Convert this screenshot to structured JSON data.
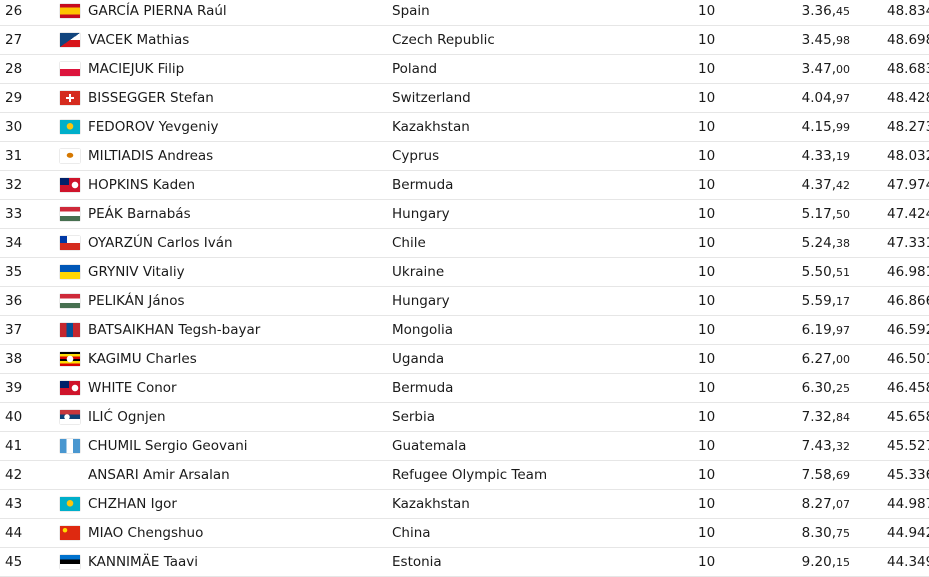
{
  "rows": [
    {
      "rank": "26",
      "name": "GARCÍA PIERNA Raúl",
      "country": "Spain",
      "flag": "spain-flag-icon",
      "laps": "10",
      "time": "3.36,",
      "time_frac": "45",
      "points": "48.834"
    },
    {
      "rank": "27",
      "name": "VACEK Mathias",
      "country": "Czech Republic",
      "flag": "czech-flag-icon",
      "laps": "10",
      "time": "3.45,",
      "time_frac": "98",
      "points": "48.698"
    },
    {
      "rank": "28",
      "name": "MACIEJUK Filip",
      "country": "Poland",
      "flag": "poland-flag-icon",
      "laps": "10",
      "time": "3.47,",
      "time_frac": "00",
      "points": "48.683"
    },
    {
      "rank": "29",
      "name": "BISSEGGER Stefan",
      "country": "Switzerland",
      "flag": "switzerland-flag-icon",
      "laps": "10",
      "time": "4.04,",
      "time_frac": "97",
      "points": "48.428"
    },
    {
      "rank": "30",
      "name": "FEDOROV Yevgeniy",
      "country": "Kazakhstan",
      "flag": "kazakhstan-flag-icon",
      "laps": "10",
      "time": "4.15,",
      "time_frac": "99",
      "points": "48.273"
    },
    {
      "rank": "31",
      "name": "MILTIADIS Andreas",
      "country": "Cyprus",
      "flag": "cyprus-flag-icon",
      "laps": "10",
      "time": "4.33,",
      "time_frac": "19",
      "points": "48.032"
    },
    {
      "rank": "32",
      "name": "HOPKINS Kaden",
      "country": "Bermuda",
      "flag": "bermuda-flag-icon",
      "laps": "10",
      "time": "4.37,",
      "time_frac": "42",
      "points": "47.974"
    },
    {
      "rank": "33",
      "name": "PEÁK Barnabás",
      "country": "Hungary",
      "flag": "hungary-flag-icon",
      "laps": "10",
      "time": "5.17,",
      "time_frac": "50",
      "points": "47.424"
    },
    {
      "rank": "34",
      "name": "OYARZÚN Carlos Iván",
      "country": "Chile",
      "flag": "chile-flag-icon",
      "laps": "10",
      "time": "5.24,",
      "time_frac": "38",
      "points": "47.331"
    },
    {
      "rank": "35",
      "name": "GRYNIV Vitaliy",
      "country": "Ukraine",
      "flag": "ukraine-flag-icon",
      "laps": "10",
      "time": "5.50,",
      "time_frac": "51",
      "points": "46.981"
    },
    {
      "rank": "36",
      "name": "PELIKÁN János",
      "country": "Hungary",
      "flag": "hungary-flag-icon",
      "laps": "10",
      "time": "5.59,",
      "time_frac": "17",
      "points": "46.866"
    },
    {
      "rank": "37",
      "name": "BATSAIKHAN Tegsh-bayar",
      "country": "Mongolia",
      "flag": "mongolia-flag-icon",
      "laps": "10",
      "time": "6.19,",
      "time_frac": "97",
      "points": "46.592"
    },
    {
      "rank": "38",
      "name": "KAGIMU Charles",
      "country": "Uganda",
      "flag": "uganda-flag-icon",
      "laps": "10",
      "time": "6.27,",
      "time_frac": "00",
      "points": "46.501"
    },
    {
      "rank": "39",
      "name": "WHITE Conor",
      "country": "Bermuda",
      "flag": "bermuda-flag-icon",
      "laps": "10",
      "time": "6.30,",
      "time_frac": "25",
      "points": "46.458"
    },
    {
      "rank": "40",
      "name": "ILIĆ Ognjen",
      "country": "Serbia",
      "flag": "serbia-flag-icon",
      "laps": "10",
      "time": "7.32,",
      "time_frac": "84",
      "points": "45.658"
    },
    {
      "rank": "41",
      "name": "CHUMIL Sergio Geovani",
      "country": "Guatemala",
      "flag": "guatemala-flag-icon",
      "laps": "10",
      "time": "7.43,",
      "time_frac": "32",
      "points": "45.527"
    },
    {
      "rank": "42",
      "name": "ANSARI Amir Arsalan",
      "country": "Refugee Olympic Team",
      "flag": "",
      "laps": "10",
      "time": "7.58,",
      "time_frac": "69",
      "points": "45.336"
    },
    {
      "rank": "43",
      "name": "CHZHAN Igor",
      "country": "Kazakhstan",
      "flag": "kazakhstan-flag-icon",
      "laps": "10",
      "time": "8.27,",
      "time_frac": "07",
      "points": "44.987"
    },
    {
      "rank": "44",
      "name": "MIAO Chengshuo",
      "country": "China",
      "flag": "china-flag-icon",
      "laps": "10",
      "time": "8.30,",
      "time_frac": "75",
      "points": "44.942"
    },
    {
      "rank": "45",
      "name": "KANNIMÄE Taavi",
      "country": "Estonia",
      "flag": "estonia-flag-icon",
      "laps": "10",
      "time": "9.20,",
      "time_frac": "15",
      "points": "44.349"
    }
  ]
}
